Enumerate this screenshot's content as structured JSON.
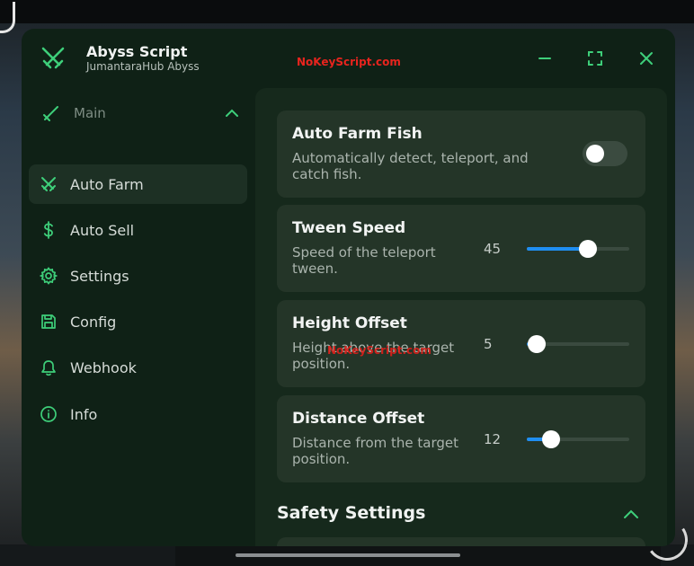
{
  "app": {
    "title": "Abyss Script",
    "subtitle": "JumantaraHub Abyss",
    "watermark": "NoKeyScript.com",
    "accent": "#1f8ef1",
    "brand_green": "#3ecf7a"
  },
  "window_controls": {
    "minimize_icon": "minus-icon",
    "maximize_icon": "fullscreen-icon",
    "close_icon": "close-icon"
  },
  "sidebar": {
    "section": {
      "label": "Main",
      "icon": "sword-icon",
      "expanded": true
    },
    "items": [
      {
        "label": "Auto Farm",
        "icon": "crossed-swords-icon",
        "active": true
      },
      {
        "label": "Auto Sell",
        "icon": "dollar-icon",
        "active": false
      },
      {
        "label": "Settings",
        "icon": "gear-icon",
        "active": false
      },
      {
        "label": "Config",
        "icon": "save-icon",
        "active": false
      },
      {
        "label": "Webhook",
        "icon": "bell-icon",
        "active": false
      },
      {
        "label": "Info",
        "icon": "info-icon",
        "active": false
      }
    ]
  },
  "main": {
    "cards": [
      {
        "title": "Auto Farm Fish",
        "description": "Automatically detect, teleport, and catch fish.",
        "toggle_on": false
      },
      {
        "title": "Tween Speed",
        "description": "Speed of the teleport tween.",
        "value": "45",
        "fill_fraction": 0.6
      },
      {
        "title": "Height Offset",
        "description": "Height above the target position.",
        "value": "5",
        "fill_fraction": 0.1,
        "watermark": "NoKeyScript.com"
      },
      {
        "title": "Distance Offset",
        "description": "Distance from the target position.",
        "value": "12",
        "fill_fraction": 0.24
      }
    ],
    "section_title": "Safety Settings"
  }
}
